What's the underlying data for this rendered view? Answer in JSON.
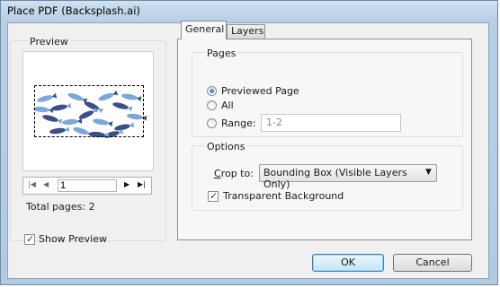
{
  "window": {
    "title": "Place PDF (Backsplash.ai)"
  },
  "preview": {
    "group_label": "Preview",
    "page_value": "1",
    "total_pages": "Total pages: 2",
    "nav": {
      "first": "⏮",
      "prev": "◀",
      "next": "▶",
      "last": "⏭"
    }
  },
  "tabs": [
    {
      "label": "General"
    },
    {
      "label": "Layers"
    }
  ],
  "pages": {
    "group_label": "Pages",
    "options": [
      {
        "label": "Previewed Page",
        "checked": true
      },
      {
        "label": "All",
        "checked": false
      },
      {
        "label": "Range:",
        "checked": false
      }
    ],
    "range_value": "1-2"
  },
  "options": {
    "group_label": "Options",
    "crop_label_prefix": "C",
    "crop_label_rest": "rop to:",
    "crop_value": "Bounding Box (Visible Layers Only)",
    "transparent_label": "Transparent Background",
    "transparent_checked": true
  },
  "footer": {
    "show_preview_label": "Show Preview",
    "show_preview_checked": true,
    "ok_label": "OK",
    "cancel_label": "Cancel"
  },
  "colors": {
    "fish_dark": "#3a4f86",
    "fish_light": "#7aa8d8",
    "accent": "#3c7fb1"
  }
}
